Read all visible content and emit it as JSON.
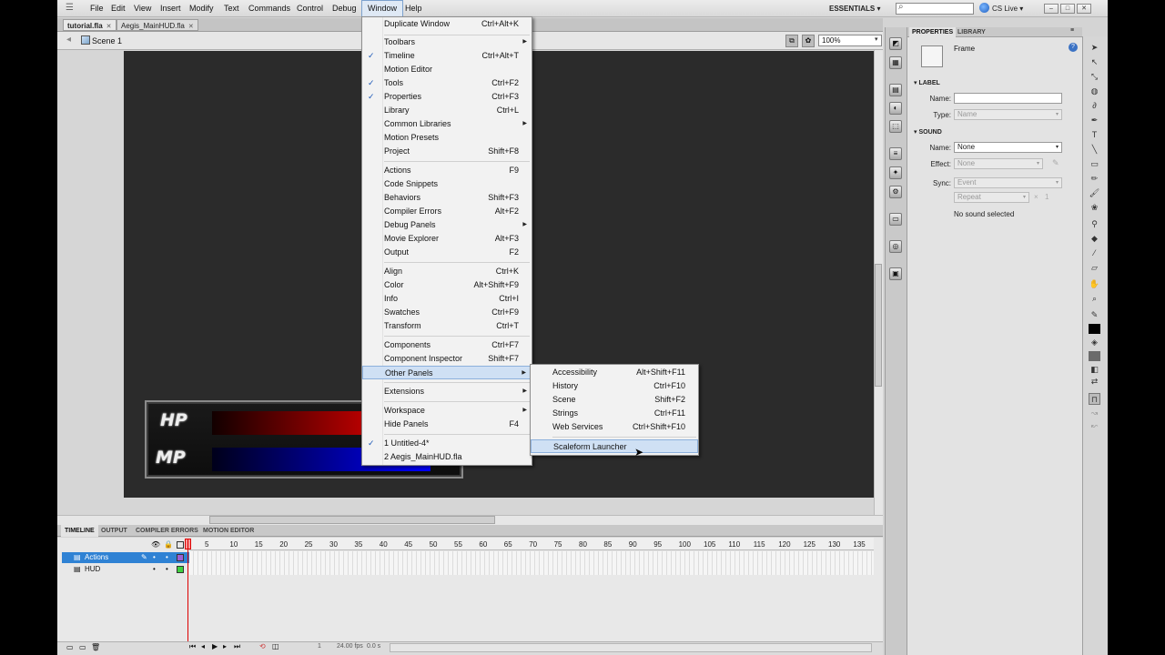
{
  "menubar": {
    "items": [
      "File",
      "Edit",
      "View",
      "Insert",
      "Modify",
      "Text",
      "Commands",
      "Control",
      "Debug",
      "Window",
      "Help"
    ],
    "workspace": "ESSENTIALS",
    "cslive": "CS Live"
  },
  "doc_tabs": [
    "tutorial.fla",
    "Aegis_MainHUD.fla"
  ],
  "scene": {
    "label": "Scene 1",
    "zoom": "100%"
  },
  "hud": {
    "hp": "HP",
    "mp": "MP"
  },
  "window_menu": [
    {
      "label": "Duplicate Window",
      "shortcut": "Ctrl+Alt+K"
    },
    {
      "label": "Toolbars",
      "submenu": true
    },
    {
      "label": "Timeline",
      "shortcut": "Ctrl+Alt+T",
      "checked": true
    },
    {
      "label": "Motion Editor"
    },
    {
      "label": "Tools",
      "shortcut": "Ctrl+F2",
      "checked": true
    },
    {
      "label": "Properties",
      "shortcut": "Ctrl+F3",
      "checked": true
    },
    {
      "label": "Library",
      "shortcut": "Ctrl+L"
    },
    {
      "label": "Common Libraries",
      "submenu": true
    },
    {
      "label": "Motion Presets"
    },
    {
      "label": "Project",
      "shortcut": "Shift+F8"
    },
    {
      "label": "Actions",
      "shortcut": "F9"
    },
    {
      "label": "Code Snippets"
    },
    {
      "label": "Behaviors",
      "shortcut": "Shift+F3"
    },
    {
      "label": "Compiler Errors",
      "shortcut": "Alt+F2"
    },
    {
      "label": "Debug Panels",
      "submenu": true
    },
    {
      "label": "Movie Explorer",
      "shortcut": "Alt+F3"
    },
    {
      "label": "Output",
      "shortcut": "F2"
    },
    {
      "label": "Align",
      "shortcut": "Ctrl+K"
    },
    {
      "label": "Color",
      "shortcut": "Alt+Shift+F9"
    },
    {
      "label": "Info",
      "shortcut": "Ctrl+I"
    },
    {
      "label": "Swatches",
      "shortcut": "Ctrl+F9"
    },
    {
      "label": "Transform",
      "shortcut": "Ctrl+T"
    },
    {
      "label": "Components",
      "shortcut": "Ctrl+F7"
    },
    {
      "label": "Component Inspector",
      "shortcut": "Shift+F7"
    },
    {
      "label": "Other Panels",
      "submenu": true,
      "highlighted": true
    },
    {
      "label": "Extensions",
      "submenu": true
    },
    {
      "label": "Workspace",
      "submenu": true
    },
    {
      "label": "Hide Panels",
      "shortcut": "F4"
    },
    {
      "label": "1 Untitled-4*",
      "checked": true
    },
    {
      "label": "2 Aegis_MainHUD.fla"
    }
  ],
  "other_panels_menu": [
    {
      "label": "Accessibility",
      "shortcut": "Alt+Shift+F11"
    },
    {
      "label": "History",
      "shortcut": "Ctrl+F10"
    },
    {
      "label": "Scene",
      "shortcut": "Shift+F2"
    },
    {
      "label": "Strings",
      "shortcut": "Ctrl+F11"
    },
    {
      "label": "Web Services",
      "shortcut": "Ctrl+Shift+F10"
    },
    {
      "label": "Scaleform Launcher",
      "highlighted": true
    }
  ],
  "timeline": {
    "tabs": [
      "TIMELINE",
      "OUTPUT",
      "COMPILER ERRORS",
      "MOTION EDITOR"
    ],
    "ticks": [
      "5",
      "10",
      "15",
      "20",
      "25",
      "30",
      "35",
      "40",
      "45",
      "50",
      "55",
      "60",
      "65",
      "70",
      "75",
      "80",
      "85",
      "90",
      "95",
      "100",
      "105",
      "110",
      "115",
      "120",
      "125",
      "130",
      "135"
    ],
    "layers": [
      "Actions",
      "HUD"
    ],
    "status": {
      "frame": "1",
      "fps": "24.00 fps",
      "time": "0.0 s"
    }
  },
  "properties": {
    "tabs": [
      "PROPERTIES",
      "LIBRARY"
    ],
    "object_type": "Frame",
    "label_section": "LABEL",
    "name_label": "Name:",
    "type_label": "Type:",
    "type_value": "Name",
    "sound_section": "SOUND",
    "sound_name_value": "None",
    "effect_label": "Effect:",
    "effect_value": "None",
    "sync_label": "Sync:",
    "sync_value": "Event",
    "repeat_value": "Repeat",
    "repeat_count": "1",
    "status": "No sound selected"
  }
}
